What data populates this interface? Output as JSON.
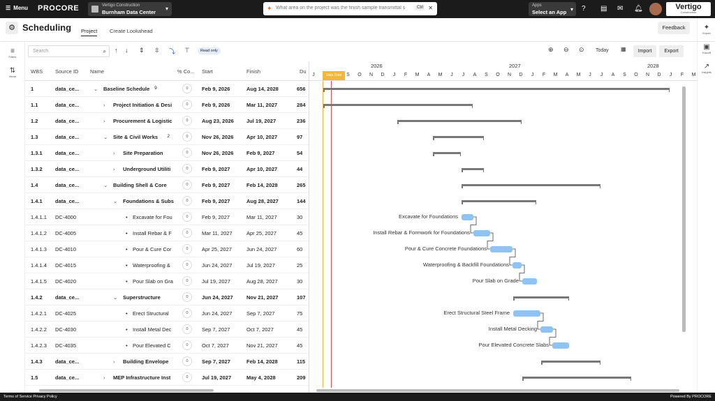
{
  "topbar": {
    "menu": "Menu",
    "logo": "PROCORE",
    "project_company": "Vertigo Construction",
    "project_name": "Burnham Data Center",
    "search_text": "What area on the project was the finish sample transmittal s",
    "search_kbd": "Ctrl",
    "apps_label": "Apps",
    "apps_value": "Select an App",
    "brand": "Vertigo",
    "brand_sub": "Construction"
  },
  "header": {
    "title": "Scheduling",
    "tab_project": "Project",
    "tab_lookahead": "Create Lookahead",
    "feedback": "Feedback"
  },
  "left_rail": {
    "filters": "Filters",
    "views": "Views"
  },
  "right_rail": {
    "export": "Export",
    "kickoff": "Kickoff",
    "insights": "Insights"
  },
  "toolbar": {
    "search_placeholder": "Search",
    "read_only": "Read only",
    "today": "Today",
    "import": "Import",
    "export": "Export"
  },
  "columns": {
    "wbs": "WBS",
    "source": "Source ID",
    "name": "Name",
    "pct": "% Co...",
    "start": "Start",
    "finish": "Finish",
    "dur": "Du"
  },
  "rows": [
    {
      "wbs": "1",
      "src": "data_ce...",
      "name": "Baseline Schedule",
      "count": "9",
      "pct": "0",
      "start": "Feb 9, 2026",
      "finish": "Aug 14, 2028",
      "dur": "656"
    },
    {
      "wbs": "1.1",
      "src": "data_ce...",
      "name": "Project Initiation & Desi",
      "pct": "0",
      "start": "Feb 9, 2026",
      "finish": "Mar 11, 2027",
      "dur": "284"
    },
    {
      "wbs": "1.2",
      "src": "data_ce...",
      "name": "Procurement & Logistic",
      "pct": "0",
      "start": "Aug 23, 2026",
      "finish": "Jul 19, 2027",
      "dur": "236"
    },
    {
      "wbs": "1.3",
      "src": "data_ce...",
      "name": "Site & Civil Works",
      "count": "2",
      "pct": "0",
      "start": "Nov 26, 2026",
      "finish": "Apr 10, 2027",
      "dur": "97"
    },
    {
      "wbs": "1.3.1",
      "src": "data_ce...",
      "name": "Site Preparation",
      "pct": "0",
      "start": "Nov 26, 2026",
      "finish": "Feb 9, 2027",
      "dur": "54"
    },
    {
      "wbs": "1.3.2",
      "src": "data_ce...",
      "name": "Underground Utiliti",
      "pct": "0",
      "start": "Feb 9, 2027",
      "finish": "Apr 10, 2027",
      "dur": "44"
    },
    {
      "wbs": "1.4",
      "src": "data_ce...",
      "name": "Building Shell & Core",
      "pct": "0",
      "start": "Feb 9, 2027",
      "finish": "Feb 14, 2028",
      "dur": "265"
    },
    {
      "wbs": "1.4.1",
      "src": "data_ce...",
      "name": "Foundations & Subs",
      "pct": "0",
      "start": "Feb 9, 2027",
      "finish": "Aug 28, 2027",
      "dur": "144"
    },
    {
      "wbs": "1.4.1.1",
      "src": "DC-4000",
      "name": "Excavate for Fou",
      "pct": "0",
      "start": "Feb 9, 2027",
      "finish": "Mar 11, 2027",
      "dur": "30"
    },
    {
      "wbs": "1.4.1.2",
      "src": "DC-4005",
      "name": "Install Rebar & F",
      "pct": "0",
      "start": "Mar 11, 2027",
      "finish": "Apr 25, 2027",
      "dur": "45"
    },
    {
      "wbs": "1.4.1.3",
      "src": "DC-4010",
      "name": "Pour & Cure Cor",
      "pct": "0",
      "start": "Apr 25, 2027",
      "finish": "Jun 24, 2027",
      "dur": "60"
    },
    {
      "wbs": "1.4.1.4",
      "src": "DC-4015",
      "name": "Waterproofing &",
      "pct": "0",
      "start": "Jun 24, 2027",
      "finish": "Jul 19, 2027",
      "dur": "25"
    },
    {
      "wbs": "1.4.1.5",
      "src": "DC-4020",
      "name": "Pour Slab on Gra",
      "pct": "0",
      "start": "Jul 19, 2027",
      "finish": "Aug 28, 2027",
      "dur": "30"
    },
    {
      "wbs": "1.4.2",
      "src": "data_ce...",
      "name": "Superstructure",
      "pct": "0",
      "start": "Jun 24, 2027",
      "finish": "Nov 21, 2027",
      "dur": "107"
    },
    {
      "wbs": "1.4.2.1",
      "src": "DC-4025",
      "name": "Erect Structural",
      "pct": "0",
      "start": "Jun 24, 2027",
      "finish": "Sep 7, 2027",
      "dur": "75"
    },
    {
      "wbs": "1.4.2.2",
      "src": "DC-4030",
      "name": "Install Metal Dec",
      "pct": "0",
      "start": "Sep 7, 2027",
      "finish": "Oct 7, 2027",
      "dur": "45"
    },
    {
      "wbs": "1.4.2.3",
      "src": "DC-4035",
      "name": "Pour Elevated C",
      "pct": "0",
      "start": "Oct 7, 2027",
      "finish": "Nov 21, 2027",
      "dur": "45"
    },
    {
      "wbs": "1.4.3",
      "src": "data_ce...",
      "name": "Building Envelope",
      "pct": "0",
      "start": "Sep 7, 2027",
      "finish": "Feb 14, 2028",
      "dur": "115"
    },
    {
      "wbs": "1.5",
      "src": "data_ce...",
      "name": "MEP Infrastructure Inst",
      "pct": "0",
      "start": "Jul 19, 2027",
      "finish": "May 4, 2028",
      "dur": "209"
    }
  ],
  "gantt": {
    "years": [
      "2026",
      "2027",
      "2028"
    ],
    "months": [
      "J",
      "J",
      "A",
      "S",
      "O",
      "N",
      "D",
      "J",
      "F",
      "M",
      "A",
      "M",
      "J",
      "J",
      "A",
      "S",
      "O",
      "N",
      "D",
      "J",
      "F",
      "M",
      "A",
      "M",
      "J",
      "J",
      "A",
      "S",
      "O",
      "N",
      "D",
      "J",
      "F",
      "M",
      "A",
      "M",
      "J",
      "J",
      "A",
      "S"
    ],
    "data_date": "Data Date",
    "labels": [
      "Excavate for Foundations",
      "Install Rebar & Formwork for Foundations",
      "Pour & Cure Concrete Foundations",
      "Waterproofing & Backfill Foundations",
      "Pour Slab on Grade",
      "Erect Structural Steel Frame",
      "Install Metal Decking",
      "Pour Elevated Concrete Slabs"
    ]
  },
  "footer": {
    "left": "Terms of Service  Privacy Policy",
    "right": "Powered By PROCORE"
  }
}
